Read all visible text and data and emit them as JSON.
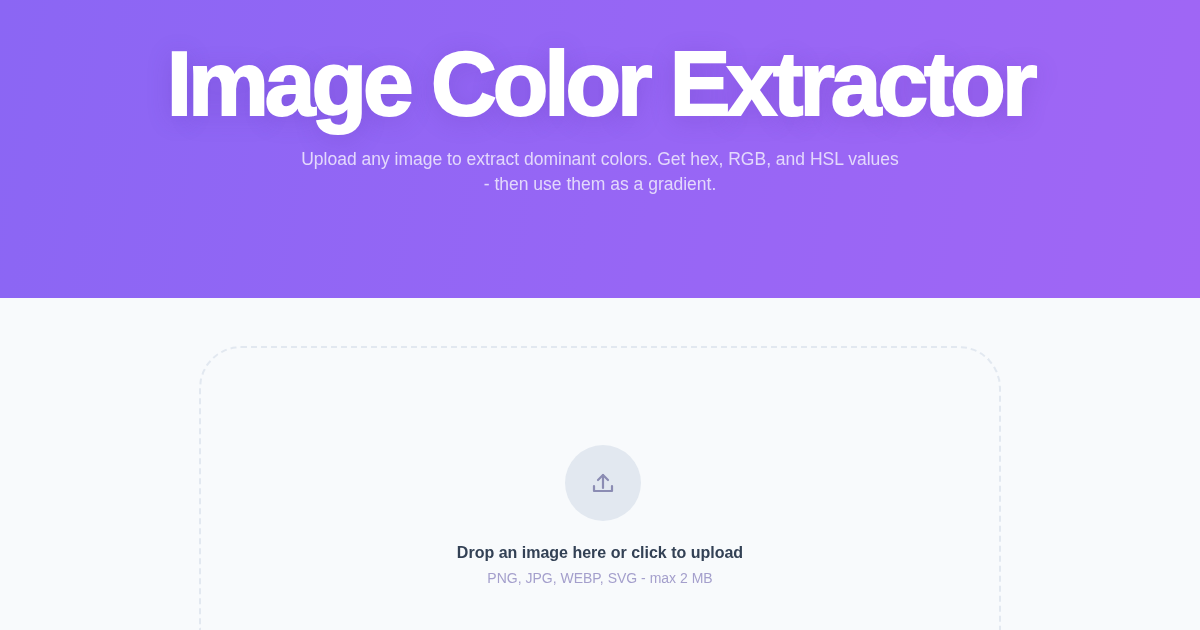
{
  "header": {
    "title": "Image Color Extractor",
    "subtitle": "Upload any image to extract dominant colors. Get hex, RGB, and HSL values - then use them as a gradient."
  },
  "upload": {
    "prompt": "Drop an image here or click to upload",
    "hint": "PNG, JPG, WEBP, SVG - max 2 MB"
  }
}
